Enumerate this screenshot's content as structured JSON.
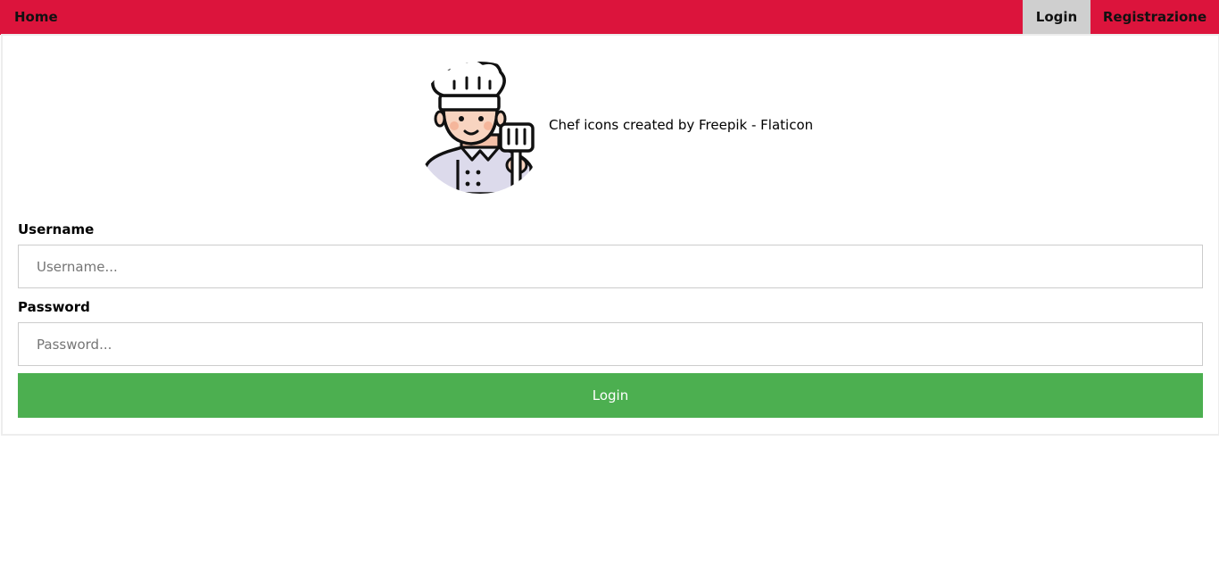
{
  "nav": {
    "home_label": "Home",
    "login_label": "Login",
    "register_label": "Registrazione"
  },
  "hero": {
    "icon": "chef-icon",
    "attribution": "Chef icons created by Freepik - Flaticon"
  },
  "form": {
    "username_label": "Username",
    "username_placeholder": "Username...",
    "username_value": "",
    "password_label": "Password",
    "password_placeholder": "Password...",
    "password_value": "",
    "submit_label": "Login"
  },
  "colors": {
    "nav_bg": "#dc143c",
    "active_tab_bg": "#cfcfcf",
    "submit_bg": "#4caf50"
  }
}
